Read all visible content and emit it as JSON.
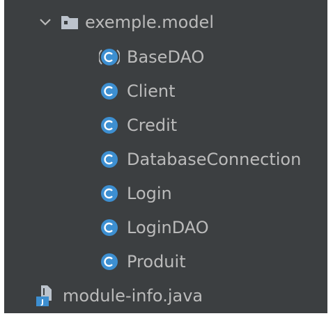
{
  "tree": {
    "package": {
      "label": "exemple.model",
      "expanded": true,
      "icon": "folder-package-icon"
    },
    "classes": [
      {
        "label": "BaseDAO",
        "icon": "abstract-class-icon"
      },
      {
        "label": "Client",
        "icon": "class-icon"
      },
      {
        "label": "Credit",
        "icon": "class-icon"
      },
      {
        "label": "DatabaseConnection",
        "icon": "class-icon"
      },
      {
        "label": "Login",
        "icon": "class-icon"
      },
      {
        "label": "LoginDAO",
        "icon": "class-icon"
      },
      {
        "label": "Produit",
        "icon": "class-icon"
      }
    ],
    "module_file": {
      "label": "module-info.java",
      "icon": "java-file-icon"
    }
  },
  "colors": {
    "background": "#3c3f41",
    "text": "#bbbbbb",
    "class_icon": "#3d8fd1",
    "folder": "#bcc3cc"
  }
}
